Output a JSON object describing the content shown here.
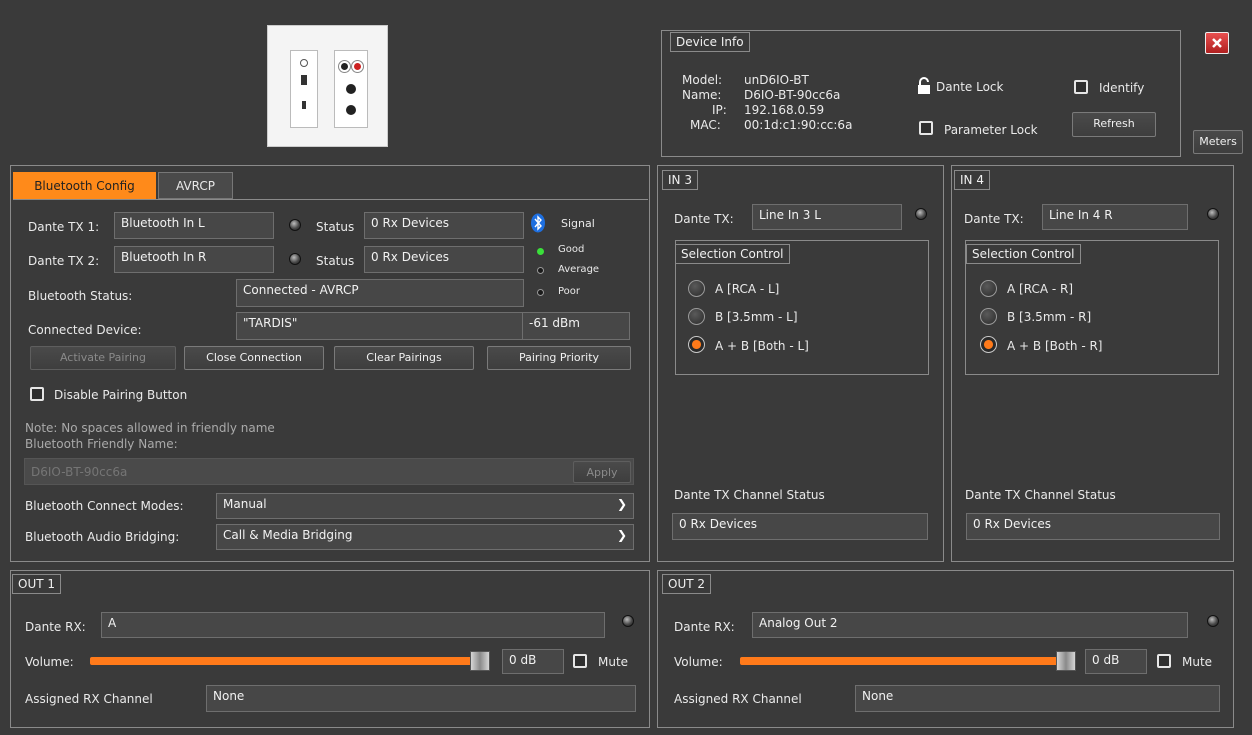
{
  "device_info": {
    "legend": "Device Info",
    "model_label": "Model:",
    "model": "unD6IO-BT",
    "name_label": "Name:",
    "name": "D6IO-BT-90cc6a",
    "ip_label": "IP:",
    "ip": "192.168.0.59",
    "mac_label": "MAC:",
    "mac": "00:1d:c1:90:cc:6a",
    "dante_lock": "Dante Lock",
    "identify": "Identify",
    "parameter_lock": "Parameter Lock",
    "refresh": "Refresh"
  },
  "meters_button": "Meters",
  "bluetooth": {
    "tabs": [
      "Bluetooth Config",
      "AVRCP"
    ],
    "tx1_label": "Dante TX 1:",
    "tx1_value": "Bluetooth In L",
    "tx2_label": "Dante TX 2:",
    "tx2_value": "Bluetooth In R",
    "status_label": "Status",
    "status1": "0 Rx Devices",
    "status2": "0 Rx Devices",
    "signal_label": "Signal",
    "signal_levels": [
      "Good",
      "Average",
      "Poor"
    ],
    "bt_status_label": "Bluetooth Status:",
    "bt_status": "Connected - AVRCP",
    "connected_device_label": "Connected Device:",
    "connected_device": "\"TARDIS\"",
    "rssi": "-61 dBm",
    "buttons": [
      "Activate Pairing",
      "Close Connection",
      "Clear Pairings",
      "Pairing Priority"
    ],
    "disable_pairing": "Disable Pairing Button",
    "note": "Note: No spaces allowed in friendly name",
    "friendly_name_label": "Bluetooth Friendly Name:",
    "friendly_name_placeholder": "D6IO-BT-90cc6a",
    "apply": "Apply",
    "connect_modes_label": "Bluetooth Connect Modes:",
    "connect_modes": "Manual",
    "audio_bridging_label": "Bluetooth Audio Bridging:",
    "audio_bridging": "Call & Media Bridging"
  },
  "in3": {
    "legend": "IN 3",
    "tx_label": "Dante TX:",
    "tx_value": "Line In 3 L",
    "selection_legend": "Selection Control",
    "options": [
      "A [RCA - L]",
      "B [3.5mm - L]",
      "A + B [Both - L]"
    ],
    "status_label": "Dante TX Channel Status",
    "status": "0 Rx Devices"
  },
  "in4": {
    "legend": "IN 4",
    "tx_label": "Dante TX:",
    "tx_value": "Line In 4 R",
    "selection_legend": "Selection Control",
    "options": [
      "A [RCA - R]",
      "B [3.5mm - R]",
      "A + B [Both - R]"
    ],
    "status_label": "Dante TX Channel Status",
    "status": "0 Rx Devices"
  },
  "out1": {
    "legend": "OUT 1",
    "rx_label": "Dante RX:",
    "rx_value": "A",
    "volume_label": "Volume:",
    "volume_value": "0 dB",
    "volume_level": 1.0,
    "mute": "Mute",
    "assigned_label": "Assigned RX Channel",
    "assigned": "None"
  },
  "out2": {
    "legend": "OUT 2",
    "rx_label": "Dante RX:",
    "rx_value": "Analog Out 2",
    "volume_label": "Volume:",
    "volume_value": "0 dB",
    "volume_level": 1.0,
    "mute": "Mute",
    "assigned_label": "Assigned RX Channel",
    "assigned": "None"
  },
  "colors": {
    "accent": "#ff7a1a",
    "background": "#3a3a3a",
    "close": "#d03030",
    "good": "#3adf3a"
  }
}
